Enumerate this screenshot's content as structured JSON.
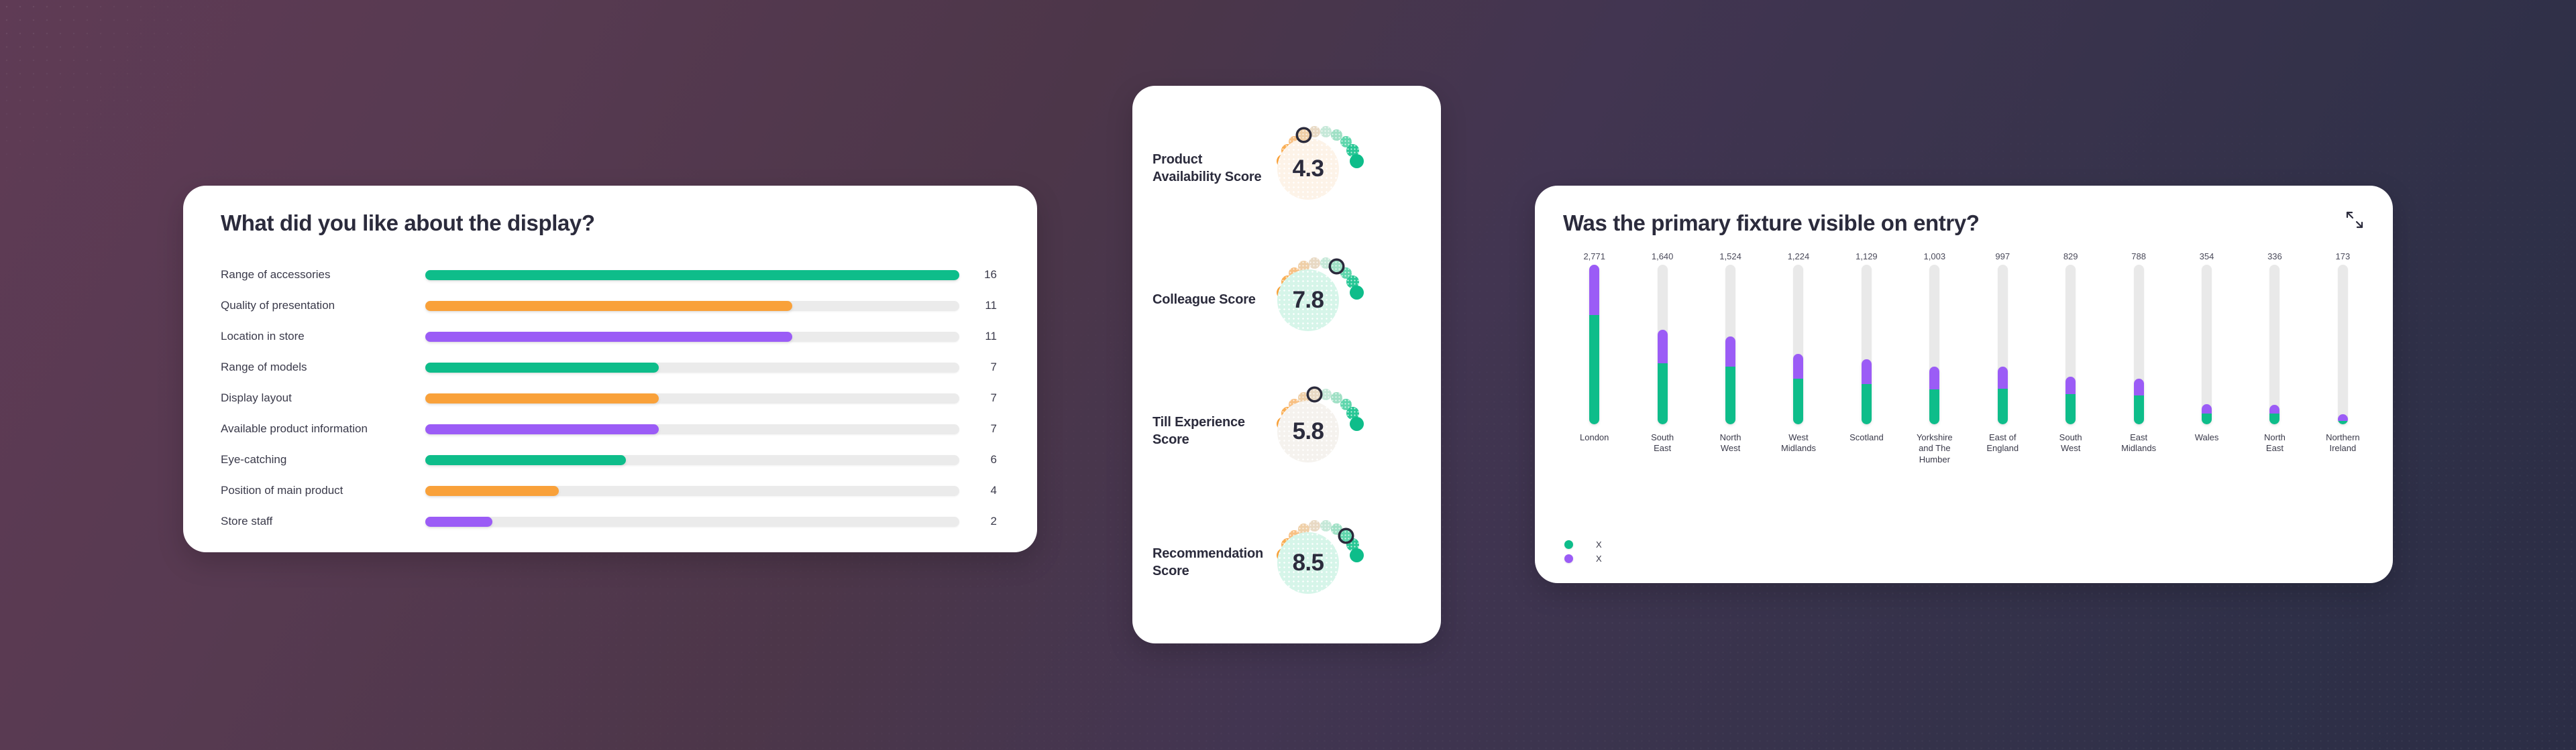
{
  "theme": {
    "green": "#0ebd8a",
    "orange": "#f9a13a",
    "purple": "#9b5cf6",
    "track": "#ebebeb",
    "text_dark": "#2b2b3c"
  },
  "bars_card": {
    "title": "What did you like about the display?",
    "max_value": 16,
    "rows": [
      {
        "label": "Range of accessories",
        "count": "16",
        "value": 16,
        "color": "#0ebd8a"
      },
      {
        "label": "Quality of presentation",
        "count": "11",
        "value": 11,
        "color": "#f9a13a"
      },
      {
        "label": "Location in store",
        "count": "11",
        "value": 11,
        "color": "#9b5cf6"
      },
      {
        "label": "Range of models",
        "count": "7",
        "value": 7,
        "color": "#0ebd8a"
      },
      {
        "label": "Display layout",
        "count": "7",
        "value": 7,
        "color": "#f9a13a"
      },
      {
        "label": "Available product information",
        "count": "7",
        "value": 7,
        "color": "#9b5cf6"
      },
      {
        "label": "Eye-catching",
        "count": "6",
        "value": 6,
        "color": "#0ebd8a"
      },
      {
        "label": "Position of main product",
        "count": "4",
        "value": 4,
        "color": "#f9a13a"
      },
      {
        "label": "Store staff",
        "count": "2",
        "value": 2,
        "color": "#9b5cf6"
      }
    ]
  },
  "scores_card": {
    "gauges": [
      {
        "label": "Product Availability Score",
        "value": "4.3",
        "score": 4.3,
        "marker_index": 3,
        "circle_bg": "#fdf3e8"
      },
      {
        "label": "Colleague Score",
        "value": "7.8",
        "score": 7.8,
        "marker_index": 6,
        "circle_bg": "#d6f5e9"
      },
      {
        "label": "Till Experience Score",
        "value": "5.8",
        "score": 5.8,
        "marker_index": 4,
        "circle_bg": "#f5f2ee"
      },
      {
        "label": "Recommendation Score",
        "value": "8.5",
        "score": 8.5,
        "marker_index": 7,
        "circle_bg": "#d6f5e9"
      }
    ],
    "dot_palette": [
      "#f9a13a",
      "#f9ad52",
      "#f8c083",
      "#efcfa7",
      "#e8d9c4",
      "#c5e8d8",
      "#9fe0c5",
      "#5fd6ac",
      "#28c795",
      "#0ebd8a"
    ]
  },
  "region_card": {
    "title": "Was the primary fixture visible on entry?",
    "expand_icon": "expand-arrows-icon",
    "max_value": 2771,
    "legend": [
      {
        "label": "X",
        "color": "#0ebd8a"
      },
      {
        "label": "X",
        "color": "#9b5cf6"
      }
    ],
    "chart_data": {
      "type": "bar",
      "title": "Was the primary fixture visible on entry?",
      "xlabel": "",
      "ylabel": "",
      "stacked": true,
      "grid": false,
      "legend_position": "bottom-left",
      "ylim": [
        0,
        2771
      ],
      "categories": [
        "London",
        "South East",
        "North West",
        "West Midlands",
        "Scotland",
        "Yorkshire and The Humber",
        "East of England",
        "South West",
        "East Midlands",
        "Wales",
        "North East",
        "Northern Ireland"
      ],
      "totals": [
        2771,
        1640,
        1524,
        1224,
        1129,
        1003,
        997,
        829,
        788,
        354,
        336,
        173
      ],
      "total_labels": [
        "2,771",
        "1,640",
        "1,524",
        "1,224",
        "1,129",
        "1,003",
        "997",
        "829",
        "788",
        "354",
        "336",
        "173"
      ],
      "series": [
        {
          "name": "X",
          "color": "#0ebd8a",
          "values": [
            1900,
            1060,
            1000,
            790,
            700,
            600,
            620,
            520,
            500,
            190,
            190,
            60
          ]
        },
        {
          "name": "X",
          "color": "#9b5cf6",
          "values": [
            871,
            580,
            524,
            434,
            429,
            403,
            377,
            309,
            288,
            164,
            146,
            113
          ]
        }
      ]
    },
    "columns": [
      {
        "name": "London",
        "value": "2,771",
        "total": 2771,
        "green": 1900,
        "purple": 871
      },
      {
        "name": "South\nEast",
        "value": "1,640",
        "total": 1640,
        "green": 1060,
        "purple": 580
      },
      {
        "name": "North\nWest",
        "value": "1,524",
        "total": 1524,
        "green": 1000,
        "purple": 524
      },
      {
        "name": "West\nMidlands",
        "value": "1,224",
        "total": 1224,
        "green": 790,
        "purple": 434
      },
      {
        "name": "Scotland",
        "value": "1,129",
        "total": 1129,
        "green": 700,
        "purple": 429
      },
      {
        "name": "Yorkshire\nand The\nHumber",
        "value": "1,003",
        "total": 1003,
        "green": 600,
        "purple": 403
      },
      {
        "name": "East of\nEngland",
        "value": "997",
        "total": 997,
        "green": 620,
        "purple": 377
      },
      {
        "name": "South\nWest",
        "value": "829",
        "total": 829,
        "green": 520,
        "purple": 309
      },
      {
        "name": "East\nMidlands",
        "value": "788",
        "total": 788,
        "green": 500,
        "purple": 288
      },
      {
        "name": "Wales",
        "value": "354",
        "total": 354,
        "green": 190,
        "purple": 164
      },
      {
        "name": "North\nEast",
        "value": "336",
        "total": 336,
        "green": 190,
        "purple": 146
      },
      {
        "name": "Northern\nIreland",
        "value": "173",
        "total": 173,
        "green": 60,
        "purple": 113
      }
    ]
  }
}
